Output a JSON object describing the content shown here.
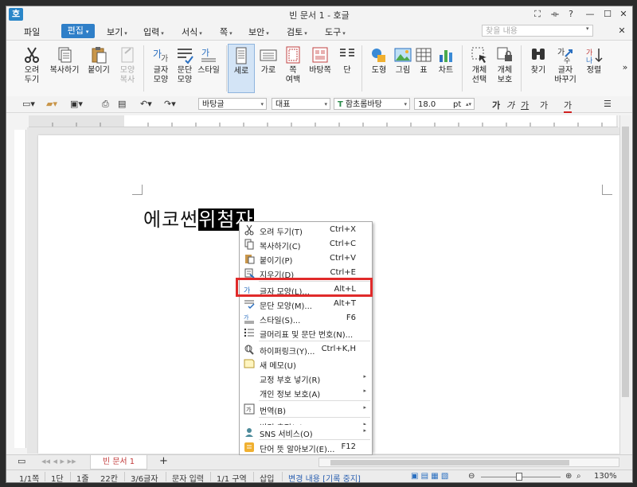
{
  "window": {
    "title": "빈 문서 1 - 호글",
    "logo": "호",
    "controls": [
      "⛶",
      "⟛",
      "?",
      "—",
      "☐",
      "✕"
    ]
  },
  "menu": {
    "items": [
      "파일",
      "편집",
      "보기",
      "입력",
      "서식",
      "쪽",
      "보안",
      "검토",
      "도구"
    ],
    "active": "편집",
    "search_placeholder": "찾을 내용",
    "close": "✕"
  },
  "ribbon": {
    "buttons": [
      {
        "label1": "오려",
        "label2": "두기",
        "icon": "scissors-icon"
      },
      {
        "label1": "복사하기",
        "label2": "",
        "icon": "copy-icon"
      },
      {
        "label1": "붙이기",
        "label2": "",
        "icon": "paste-icon"
      },
      {
        "label1": "모양",
        "label2": "복사",
        "icon": "format-painter-icon",
        "disabled": true
      },
      {
        "label1": "글자",
        "label2": "모양",
        "icon": "char-shape-icon"
      },
      {
        "label1": "문단",
        "label2": "모양",
        "icon": "para-shape-icon"
      },
      {
        "label1": "스타일",
        "label2": "",
        "icon": "style-icon"
      },
      {
        "label1": "세로",
        "label2": "",
        "icon": "portrait-icon",
        "selected": true
      },
      {
        "label1": "가로",
        "label2": "",
        "icon": "landscape-icon"
      },
      {
        "label1": "쪽",
        "label2": "여백",
        "icon": "margin-icon"
      },
      {
        "label1": "바탕쪽",
        "label2": "",
        "icon": "master-page-icon"
      },
      {
        "label1": "단",
        "label2": "",
        "icon": "columns-icon"
      },
      {
        "label1": "도형",
        "label2": "",
        "icon": "shape-icon"
      },
      {
        "label1": "그림",
        "label2": "",
        "icon": "picture-icon"
      },
      {
        "label1": "표",
        "label2": "",
        "icon": "table-icon"
      },
      {
        "label1": "차트",
        "label2": "",
        "icon": "chart-icon"
      },
      {
        "label1": "개체",
        "label2": "선택",
        "icon": "object-select-icon"
      },
      {
        "label1": "개체",
        "label2": "보호",
        "icon": "object-protect-icon"
      },
      {
        "label1": "찾기",
        "label2": "",
        "icon": "find-icon"
      },
      {
        "label1": "글자",
        "label2": "바꾸기",
        "icon": "replace-icon"
      },
      {
        "label1": "정렬",
        "label2": "",
        "icon": "sort-icon"
      }
    ]
  },
  "toolbar2": {
    "style": "바탕글",
    "script": "대표",
    "font": "함초롬바탕",
    "size": "18.0",
    "unit": "pt",
    "font_icon": "T",
    "char_buttons": [
      "가",
      "가",
      "가",
      "가",
      "가"
    ]
  },
  "document": {
    "text_plain": "에코썬",
    "text_selected": "위첨자"
  },
  "context_menu": {
    "items": [
      {
        "label": "오려 두기(T)",
        "key": "Ctrl+X",
        "icon": "scissors-icon"
      },
      {
        "label": "복사하기(C)",
        "key": "Ctrl+C",
        "icon": "copy-icon"
      },
      {
        "label": "붙이기(P)",
        "key": "Ctrl+V",
        "icon": "paste-icon"
      },
      {
        "label": "지우기(D)",
        "key": "Ctrl+E",
        "icon": "erase-icon"
      },
      {
        "label": "글자 모양(L)...",
        "key": "Alt+L",
        "icon": "char-shape-icon",
        "highlighted": true
      },
      {
        "label": "문단 모양(M)...",
        "key": "Alt+T",
        "icon": "para-shape-icon"
      },
      {
        "label": "스타일(S)...",
        "key": "F6",
        "icon": "style-icon"
      },
      {
        "label": "글머리표 및 문단 번호(N)...",
        "key": "",
        "icon": "bullet-icon"
      },
      {
        "label": "하이퍼링크(Y)...",
        "key": "Ctrl+K,H",
        "icon": "hyperlink-icon"
      },
      {
        "label": "새 메모(U)",
        "key": "",
        "icon": "memo-icon"
      },
      {
        "label": "교정 부호 넣기(R)",
        "key": "",
        "icon": "",
        "submenu": true
      },
      {
        "label": "개인 정보 보호(A)",
        "key": "",
        "icon": "",
        "submenu": true
      },
      {
        "label": "번역(B)",
        "key": "",
        "icon": "translate-icon",
        "submenu": true
      },
      {
        "label": "변경 추적(K)",
        "key": "",
        "icon": "",
        "submenu": true
      },
      {
        "label": "SNS 서비스(O)",
        "key": "",
        "icon": "sns-icon",
        "submenu": true
      },
      {
        "label": "단어 뜻 알아보기(E)...",
        "key": "F12",
        "icon": "dictionary-icon"
      }
    ]
  },
  "tabs": {
    "doc_tab": "빈 문서 1",
    "add": "+"
  },
  "status": {
    "page": "1/1쪽",
    "column": "1단",
    "line": "1줄",
    "char": "22칸",
    "count": "3/6글자",
    "mode": "문자 입력",
    "section": "1/1 구역",
    "insert": "삽입",
    "track": "변경 내용 [기록 중지]",
    "zoom": "130%"
  }
}
